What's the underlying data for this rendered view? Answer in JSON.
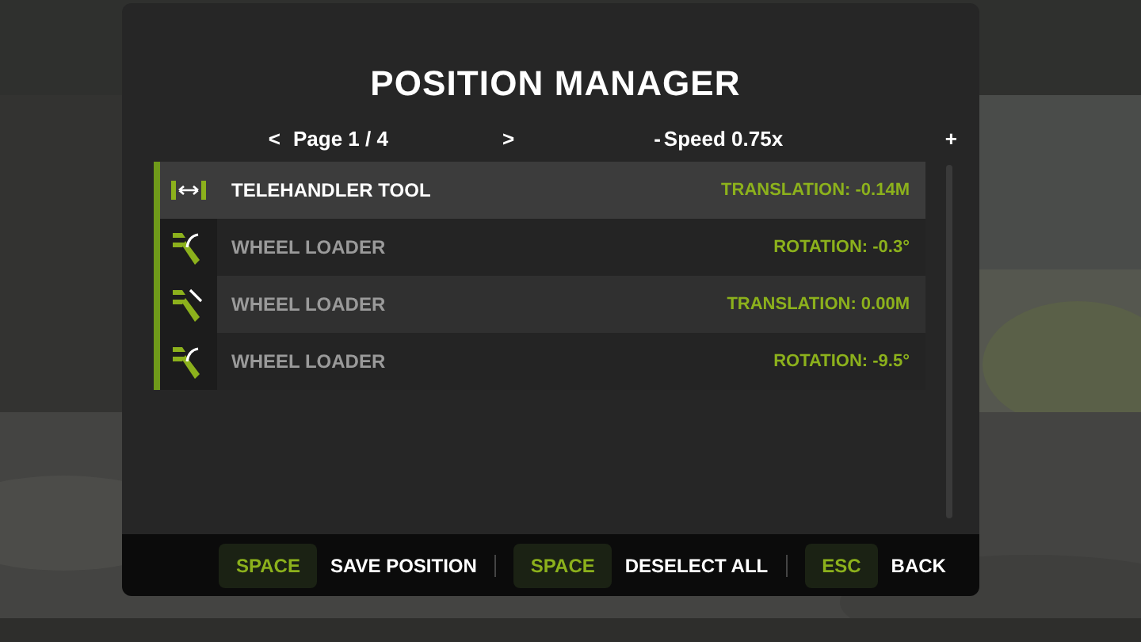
{
  "title": "POSITION MANAGER",
  "pager": {
    "prev": "<",
    "label": "Page 1 / 4",
    "next": ">"
  },
  "speed": {
    "minus": "-",
    "label": "Speed 0.75x",
    "plus": "+"
  },
  "rows": [
    {
      "kind": "width",
      "name": "TELEHANDLER TOOL",
      "value": "TRANSLATION: -0.14M",
      "selected": true
    },
    {
      "kind": "rotation",
      "name": "WHEEL LOADER",
      "value": "ROTATION: -0.3°",
      "selected": false
    },
    {
      "kind": "translation",
      "name": "WHEEL LOADER",
      "value": "TRANSLATION: 0.00M",
      "selected": false
    },
    {
      "kind": "rotation",
      "name": "WHEEL LOADER",
      "value": "ROTATION: -9.5°",
      "selected": false
    }
  ],
  "actions": [
    {
      "key": "SPACE",
      "label": "SAVE POSITION"
    },
    {
      "key": "SPACE",
      "label": "DESELECT ALL"
    },
    {
      "key": "ESC",
      "label": "BACK"
    }
  ]
}
